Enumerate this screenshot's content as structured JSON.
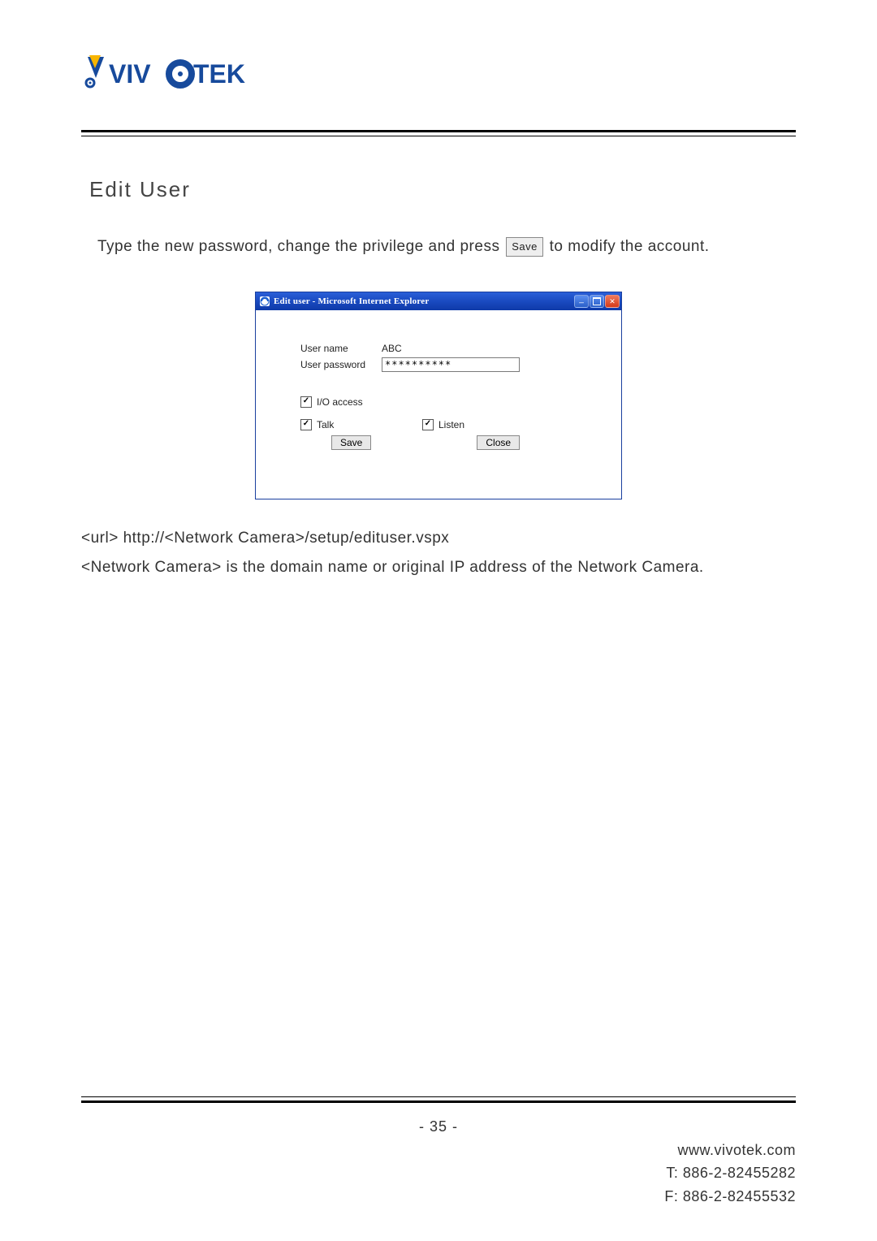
{
  "header": {
    "brand": "VIVOTEK"
  },
  "section": {
    "title": "Edit User",
    "instruction_pre": "Type the new password, change the privilege and press ",
    "save_btn_inline": "Save",
    "instruction_post": " to modify the account."
  },
  "dialog": {
    "titlebar": "Edit user - Microsoft Internet Explorer",
    "username_label": "User name",
    "username_value": "ABC",
    "password_label": "User password",
    "password_value": "**********",
    "io_access_label": "I/O access",
    "talk_label": "Talk",
    "listen_label": "Listen",
    "save_btn": "Save",
    "close_btn": "Close",
    "io_access_checked": true,
    "talk_checked": true,
    "listen_checked": true
  },
  "below": {
    "url_line": "<url> http://<Network Camera>/setup/edituser.vspx",
    "desc_line": "<Network Camera> is the domain name or original IP address of the Network Camera."
  },
  "footer": {
    "page_num": "- 35 -",
    "site": "www.vivotek.com",
    "tel": "T: 886-2-82455282",
    "fax": "F: 886-2-82455532"
  }
}
